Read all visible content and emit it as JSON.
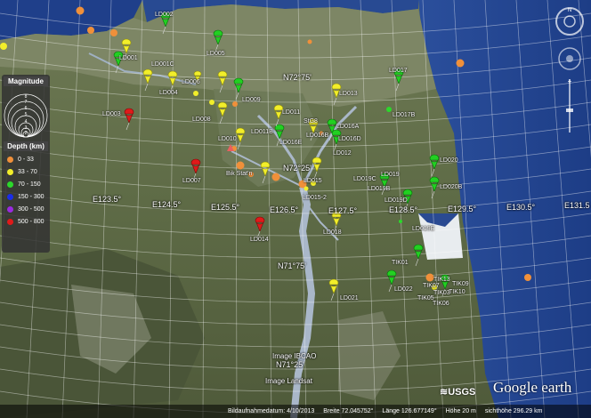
{
  "labels": {
    "LD002": "LD002",
    "LD001": "LD001",
    "LD001C": "LD001C",
    "LD005": "LD005",
    "LD006": "LD006",
    "LD004": "LD004",
    "LD003": "LD003",
    "LD008": "LD008",
    "LD009": "LD009",
    "LD010": "LD010",
    "LD007": "LD007",
    "LD011": "LD011",
    "LD011B": "LD011B",
    "LD013": "LD013",
    "LD016E": "LD016E",
    "LD016B": "LD016B",
    "LD016A": "LD016A",
    "LD016D": "LD016D",
    "LD012": "LD012",
    "LD015": "LD015",
    "LD015_2": "LD015-2",
    "LD017": "LD017",
    "LD017B": "LD017B",
    "LD019": "LD019",
    "LD019C": "LD019C",
    "LD019B": "LD019B",
    "LD019D": "LD019D",
    "LD019E": "LD019E",
    "LD020": "LD020",
    "LD020B": "LD020B",
    "LD018": "LD018",
    "LD014": "LD014",
    "LD021": "LD021",
    "LD022": "LD022",
    "TIK01": "TIK01",
    "TIK13": "TIK13",
    "TIK10": "TIK10",
    "TIK09": "TIK09",
    "TIK07": "TIK07",
    "TIK06": "TIK06",
    "TIK05": "TIK05",
    "TIK03": "TIK03",
    "BikStation": "Bik Stat'n",
    "StG8": "StG8"
  },
  "coords": {
    "N72_75": "N72°75'",
    "N72_25": "N72°25'",
    "N71_75": "N71°75'",
    "N71_25": "N71°25'",
    "E123_5": "E123.5°",
    "E124_5": "E124.5°",
    "E125_5": "E125.5°",
    "E126_5": "E126.5°",
    "E127_5": "E127.5°",
    "E128_5": "E128.5°",
    "E129_5": "E129.5°",
    "E130_5": "E130.5°",
    "E131_5": "E131.5"
  },
  "legend": {
    "magnitude_title": "Magnitude",
    "depth_title": "Depth (km)",
    "depths": [
      {
        "label": "0 - 33",
        "color": "#f0903a"
      },
      {
        "label": "33 - 70",
        "color": "#f2ee2a"
      },
      {
        "label": "70 - 150",
        "color": "#2bd82b"
      },
      {
        "label": "150 - 300",
        "color": "#1a2de8"
      },
      {
        "label": "300 - 500",
        "color": "#9a2ae0"
      },
      {
        "label": "500 - 800",
        "color": "#e01a1a"
      }
    ],
    "mag_ticks": [
      "8",
      "7",
      "6",
      "5",
      "4",
      "3",
      "2"
    ]
  },
  "imagery": {
    "credit_1": "Image IBCAO",
    "credit_2": "Image Landsat"
  },
  "status_bar": {
    "date": "Bildaufnahmedatum: 4/10/2013",
    "lat": "Breite   72.045752°",
    "lon": "Länge  126.677149°",
    "elev": "Höhe    20 m",
    "eye": "sichthöhe  296.29 km"
  },
  "branding": {
    "usgs": "USGS",
    "google_earth": "Google earth"
  },
  "colors": {
    "shallow": "#f0903a",
    "intermediate": "#f2ee2a",
    "green_pin": "#22d022",
    "red_pin": "#e01a1a"
  }
}
